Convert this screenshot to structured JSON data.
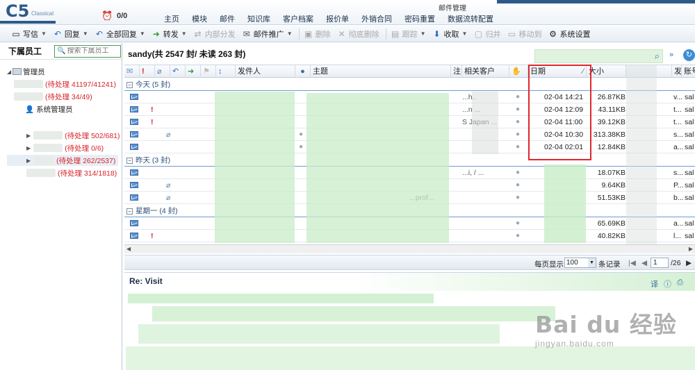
{
  "header": {
    "logo": "C5",
    "logo_sub": "Classical",
    "clock_count": "0/0",
    "section_title": "邮件管理",
    "nav": [
      "主页",
      "模块",
      "邮件",
      "知识库",
      "客户档案",
      "报价单",
      "外销合同",
      "密码重置",
      "数据流转配置"
    ]
  },
  "toolbar": {
    "items": [
      {
        "label": "写信",
        "icon": "compose-icon",
        "caret": true,
        "disabled": false
      },
      {
        "label": "回复",
        "icon": "reply-icon",
        "caret": true,
        "disabled": false
      },
      {
        "label": "全部回复",
        "icon": "reply-all-icon",
        "caret": true,
        "disabled": false
      },
      {
        "label": "转发",
        "icon": "forward-icon",
        "caret": true,
        "disabled": false
      },
      {
        "label": "内部分发",
        "icon": "distribute-icon",
        "caret": false,
        "disabled": true
      },
      {
        "label": "邮件推广",
        "icon": "promote-icon",
        "caret": true,
        "disabled": false
      },
      {
        "label": "删除",
        "icon": "delete-icon",
        "caret": false,
        "disabled": true
      },
      {
        "label": "彻底删除",
        "icon": "purge-icon",
        "caret": false,
        "disabled": true
      },
      {
        "label": "跟踪",
        "icon": "track-icon",
        "caret": true,
        "disabled": true
      },
      {
        "label": "收取",
        "icon": "receive-icon",
        "caret": true,
        "disabled": false
      },
      {
        "label": "归并",
        "icon": "merge-icon",
        "caret": false,
        "disabled": true
      },
      {
        "label": "移动到",
        "icon": "move-icon",
        "caret": false,
        "disabled": true
      },
      {
        "label": "系统设置",
        "icon": "gear-icon",
        "caret": false,
        "disabled": false
      }
    ]
  },
  "left": {
    "title": "下属员工",
    "search_placeholder": "搜索下属员工",
    "root_label": "管理员",
    "root_count": "(待处理 41197/41241)",
    "sub1_count": "(待处理 34/49)",
    "sysadmin": "系统管理员",
    "c1": "(待处理 502/681)",
    "c2": "(待处理 0/6)",
    "c3": "(待处理 262/2537)",
    "c4": "(待处理 314/1818)"
  },
  "list": {
    "title": "sandy(共 2547 封/  未读  263 封)",
    "columns": {
      "sender": "发件人",
      "subject": "主题",
      "note": "注.",
      "customer": "相关客户",
      "date": "日期",
      "size": "大小",
      "from_account": "发.",
      "account": "账号"
    },
    "groups": [
      {
        "label": "今天 (5 封)"
      },
      {
        "label": "昨天 (3 封)"
      },
      {
        "label": "星期一 (4 封)"
      }
    ],
    "rows_today": [
      {
        "excl": false,
        "clip": false,
        "dot": false,
        "customer": "...h..",
        "date": "02-04 14:21",
        "size": "26.87KB",
        "fa": "v...",
        "acc": "sal"
      },
      {
        "excl": true,
        "clip": false,
        "dot": false,
        "customer": "...n ...",
        "date": "02-04 12:09",
        "size": "43.11KB",
        "fa": "t...",
        "acc": "sal"
      },
      {
        "excl": true,
        "clip": false,
        "dot": false,
        "customer": "S Japan ...",
        "date": "02-04 11:00",
        "size": "39.12KB",
        "fa": "t...",
        "acc": "sal"
      },
      {
        "excl": false,
        "clip": true,
        "dot": true,
        "customer": "",
        "date": "02-04 10:30",
        "size": "313.38KB",
        "fa": "s...",
        "acc": "sal"
      },
      {
        "excl": false,
        "clip": false,
        "dot": true,
        "customer": "",
        "date": "02-04 02:01",
        "size": "12.84KB",
        "fa": "a...",
        "acc": "sal"
      }
    ],
    "rows_yesterday": [
      {
        "excl": false,
        "clip": false,
        "customer": "...i, / ...",
        "size": "18.07KB",
        "fa": "s...",
        "acc": "sal"
      },
      {
        "excl": false,
        "clip": true,
        "customer": "",
        "size": "9.64KB",
        "fa": "P...",
        "acc": "sal"
      },
      {
        "excl": false,
        "clip": true,
        "customer": "...prof...",
        "size": "51.53KB",
        "fa": "b...",
        "acc": "sal"
      }
    ],
    "rows_monday": [
      {
        "excl": false,
        "clip": false,
        "customer": "",
        "size": "65.69KB",
        "fa": "a...",
        "acc": "sal"
      },
      {
        "excl": true,
        "clip": false,
        "customer": "",
        "size": "40.82KB",
        "fa": "l...",
        "acc": "sal"
      }
    ]
  },
  "pager": {
    "per_page_label": "每页显示",
    "per_page": "100",
    "records_label": "条记录",
    "page": "1",
    "total_pages": "/26"
  },
  "preview": {
    "title": "Re: Visit",
    "icons": [
      "translate-icon",
      "info-icon",
      "print-icon"
    ]
  },
  "watermark": {
    "main": "Bai du 经验",
    "sub": "jingyan.baidu.com"
  },
  "colors": {
    "accent": "#2e5a8a",
    "alert": "#d8232a",
    "highlight_box": "#e0262d",
    "blur_green": "#c8ecc8"
  }
}
